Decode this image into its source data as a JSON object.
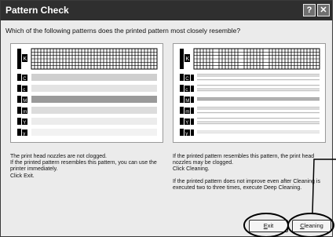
{
  "window": {
    "title": "Pattern Check",
    "help_glyph": "?",
    "close_glyph": "✕"
  },
  "question": "Which of the following patterns does the printed pattern most closely resemble?",
  "pattern_labels": [
    "K",
    "C",
    "c",
    "M",
    "m",
    "Y",
    "y"
  ],
  "left_panel": {
    "state": "not-clogged",
    "lines": [
      "The print head nozzles are not clogged.",
      "If the printed pattern resembles this pattern, you can use the",
      "printer immediately.",
      "Click Exit."
    ]
  },
  "right_panel": {
    "state": "clogged",
    "paragraph1": [
      "If the printed pattern resembles this pattern, the print head",
      "nozzles may be clogged.",
      "Click Cleaning."
    ],
    "paragraph2": [
      "If the printed pattern does not improve even after Cleaning is",
      "executed two to three times, execute Deep Cleaning."
    ]
  },
  "buttons": {
    "exit": {
      "mnemonic": "E",
      "rest": "xit"
    },
    "cleaning": {
      "mnemonic": "C",
      "rest": "leaning"
    }
  },
  "colors": {
    "title_bar": "#2f2f2f",
    "dialog_bg": "#ebebeb",
    "callout": "#000000"
  }
}
